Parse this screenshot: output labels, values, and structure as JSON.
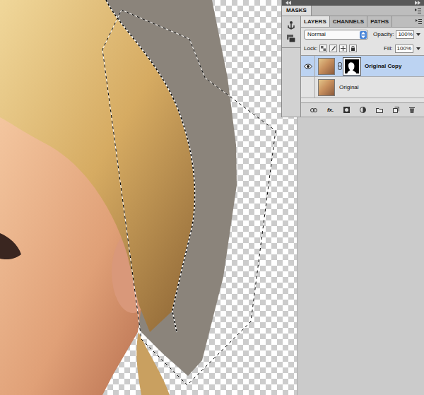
{
  "masks_panel": {
    "title": "MASKS"
  },
  "layers_panel": {
    "tabs": [
      {
        "label": "LAYERS",
        "selected": true
      },
      {
        "label": "CHANNELS",
        "selected": false
      },
      {
        "label": "PATHS",
        "selected": false
      }
    ],
    "blend_mode": "Normal",
    "opacity_label": "Opacity:",
    "opacity": "100%",
    "lock_label": "Lock:",
    "fill_label": "Fill:",
    "fill": "100%",
    "layers": [
      {
        "name": "Original Copy",
        "visible": true,
        "selected": true,
        "has_mask": true
      },
      {
        "name": "Original",
        "visible": false,
        "selected": false,
        "has_mask": false
      }
    ],
    "style_button": "fx."
  }
}
